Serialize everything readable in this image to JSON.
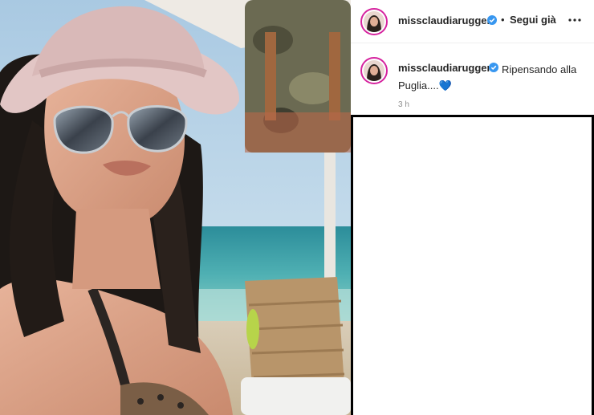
{
  "post": {
    "username": "missclaudiaruggeri",
    "follow_label": "Segui già",
    "separator": "•",
    "caption_text": "Ripensando alla Puglia....💙",
    "timestamp": "3 h",
    "more_icon": "more-horizontal-icon",
    "verified_icon": "verified-badge-icon",
    "colors": {
      "verified": "#3897f0",
      "avatar_ring": "#d6249f",
      "text": "#262626",
      "muted": "#8e8e8e"
    }
  }
}
